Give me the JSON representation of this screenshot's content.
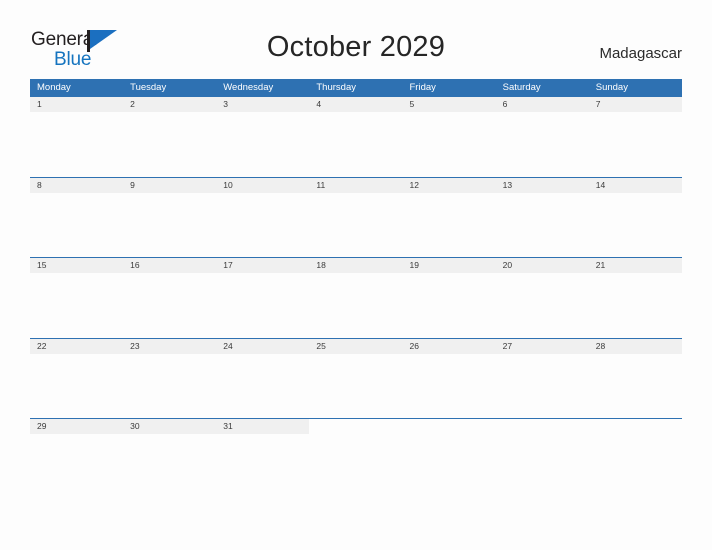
{
  "brand": {
    "name_part1": "General",
    "name_part2": "Blue",
    "flag_icon": "triangle-flag-icon"
  },
  "header": {
    "title": "October 2029",
    "country": "Madagascar"
  },
  "colors": {
    "header_blue": "#2e71b2",
    "date_band_gray": "#f0f0f0",
    "brand_blue": "#1574bf",
    "page_background": "#fdfdfd"
  },
  "calendar": {
    "month": "October",
    "year": "2029",
    "weekday_headers": [
      "Monday",
      "Tuesday",
      "Wednesday",
      "Thursday",
      "Friday",
      "Saturday",
      "Sunday"
    ],
    "weeks": [
      [
        "1",
        "2",
        "3",
        "4",
        "5",
        "6",
        "7"
      ],
      [
        "8",
        "9",
        "10",
        "11",
        "12",
        "13",
        "14"
      ],
      [
        "15",
        "16",
        "17",
        "18",
        "19",
        "20",
        "21"
      ],
      [
        "22",
        "23",
        "24",
        "25",
        "26",
        "27",
        "28"
      ],
      [
        "29",
        "30",
        "31",
        "",
        "",
        "",
        ""
      ]
    ]
  }
}
